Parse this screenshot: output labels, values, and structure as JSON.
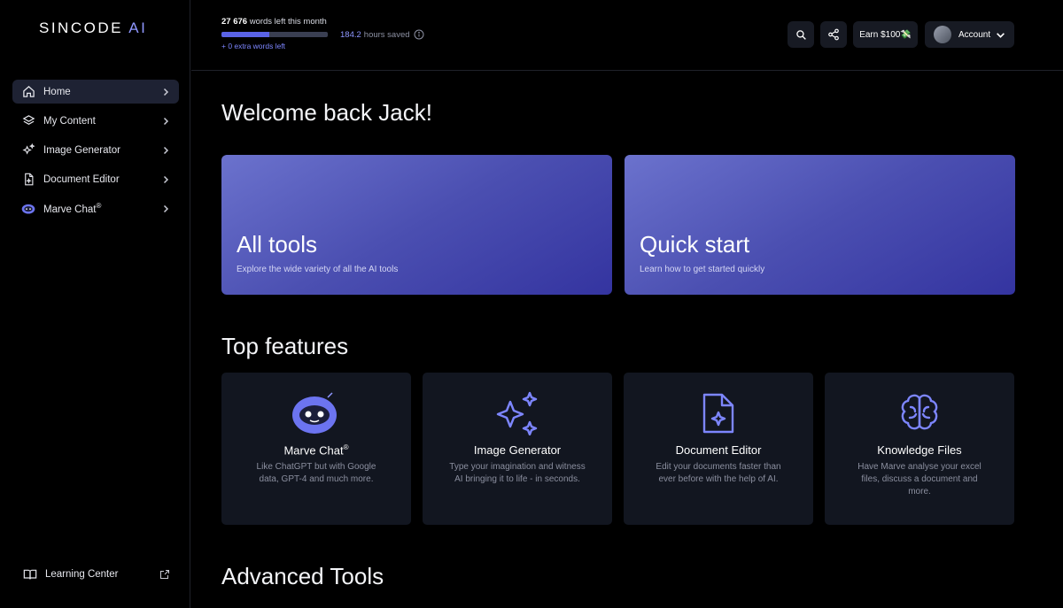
{
  "brand": {
    "name": "SINCODE",
    "suffix": "AI"
  },
  "sidebar": {
    "items": [
      {
        "label": "Home",
        "active": true,
        "icon": "home-icon"
      },
      {
        "label": "My Content",
        "icon": "layers-icon"
      },
      {
        "label": "Image Generator",
        "icon": "sparkles-icon"
      },
      {
        "label": "Document Editor",
        "icon": "document-icon"
      },
      {
        "label": "Marve Chat",
        "sup": "®",
        "icon": "bot-icon"
      }
    ],
    "footer": {
      "label": "Learning Center",
      "icon": "book-icon",
      "external_icon": "external-link-icon"
    }
  },
  "topbar": {
    "words_count": "27 676",
    "words_text": "words left this month",
    "words_progress": 0.45,
    "extra_words": "+ 0 extra words left",
    "hours_value": "184.2",
    "hours_text": "hours saved",
    "earn_label": "Earn $100💸",
    "account_label": "Account"
  },
  "main": {
    "welcome": "Welcome back Jack!",
    "cards": [
      {
        "title": "All tools",
        "desc": "Explore the wide variety of all the AI tools"
      },
      {
        "title": "Quick start",
        "desc": "Learn how to get started quickly"
      }
    ],
    "top_features_heading": "Top features",
    "features": [
      {
        "title": "Marve Chat",
        "sup": "®",
        "desc": "Like ChatGPT but with Google data, GPT-4 and much more.",
        "icon": "bot-icon"
      },
      {
        "title": "Image Generator",
        "sup": "",
        "desc": "Type your imagination and witness AI bringing it to life - in seconds.",
        "icon": "sparkles-icon"
      },
      {
        "title": "Document Editor",
        "sup": "",
        "desc": "Edit your documents faster than ever before with the help of AI.",
        "icon": "document-icon"
      },
      {
        "title": "Knowledge Files",
        "sup": "",
        "desc": "Have Marve analyse your excel files, discuss a document and more.",
        "icon": "brain-icon"
      }
    ],
    "advanced_heading": "Advanced Tools"
  },
  "colors": {
    "accent": "#5a63e6",
    "card_bg": "#121620",
    "background": "#000000"
  }
}
